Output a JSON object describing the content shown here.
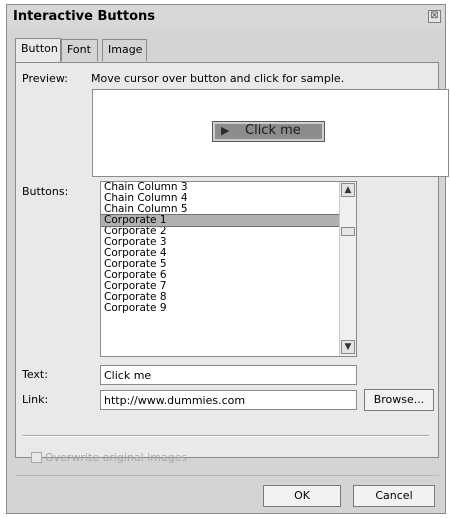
{
  "dialog": {
    "title": "Interactive Buttons",
    "close_glyph": "⊠"
  },
  "tabs": [
    {
      "label": "Button",
      "active": true
    },
    {
      "label": "Font",
      "active": false
    },
    {
      "label": "Image",
      "active": false
    }
  ],
  "preview": {
    "label": "Preview:",
    "hint": "Move cursor over button and click for sample.",
    "sample_button_text": "Click me",
    "sample_button_arrow": "▶"
  },
  "buttons_list": {
    "label": "Buttons:",
    "items": [
      "Chain Column 3",
      "Chain Column 4",
      "Chain Column 5",
      "Corporate 1",
      "Corporate 2",
      "Corporate 3",
      "Corporate 4",
      "Corporate 5",
      "Corporate 6",
      "Corporate 7",
      "Corporate 8",
      "Corporate 9"
    ],
    "selected_index": 3,
    "scroll_up_glyph": "▲",
    "scroll_down_glyph": "▼"
  },
  "text_field": {
    "label": "Text:",
    "value": "Click me"
  },
  "link_field": {
    "label": "Link:",
    "value": "http://www.dummies.com",
    "browse_label": "Browse..."
  },
  "overwrite": {
    "label": "Overwrite original images",
    "checked": false
  },
  "footer": {
    "ok_label": "OK",
    "cancel_label": "Cancel"
  },
  "colors": {
    "dialog_bg": "#d4d4d4",
    "panel_bg": "#e9e9e9",
    "selection": "#b0b0b0",
    "sample_button": "#8c8c8c"
  }
}
